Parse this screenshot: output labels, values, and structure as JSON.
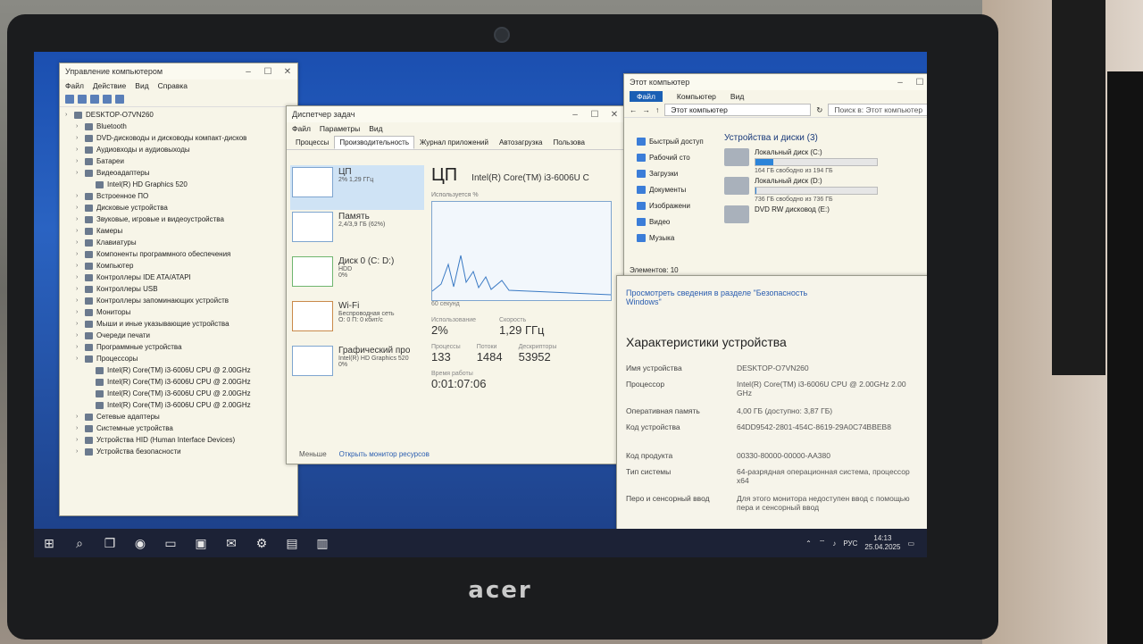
{
  "laptop": {
    "brand": "acer"
  },
  "computer_management": {
    "title": "Управление компьютером",
    "menu": [
      "Файл",
      "Действие",
      "Вид",
      "Справка"
    ],
    "tree": [
      "DESKTOP-O7VN260",
      "Bluetooth",
      "DVD-дисководы и дисководы компакт-дисков",
      "Аудиовходы и аудиовыходы",
      "Батареи",
      "Видеоадаптеры",
      "Intel(R) HD Graphics 520",
      "Встроенное ПО",
      "Дисковые устройства",
      "Звуковые, игровые и видеоустройства",
      "Камеры",
      "Клавиатуры",
      "Компоненты программного обеспечения",
      "Компьютер",
      "Контроллеры IDE ATA/ATAPI",
      "Контроллеры USB",
      "Контроллеры запоминающих устройств",
      "Мониторы",
      "Мыши и иные указывающие устройства",
      "Очереди печати",
      "Программные устройства",
      "Процессоры",
      "Intel(R) Core(TM) i3-6006U CPU @ 2.00GHz",
      "Intel(R) Core(TM) i3-6006U CPU @ 2.00GHz",
      "Intel(R) Core(TM) i3-6006U CPU @ 2.00GHz",
      "Intel(R) Core(TM) i3-6006U CPU @ 2.00GHz",
      "Сетевые адаптеры",
      "Системные устройства",
      "Устройства HID (Human Interface Devices)",
      "Устройства безопасности"
    ]
  },
  "task_manager": {
    "title": "Диспетчер задач",
    "menu": [
      "Файл",
      "Параметры",
      "Вид"
    ],
    "tabs": [
      "Процессы",
      "Производительность",
      "Журнал приложений",
      "Автозагрузка",
      "Пользова"
    ],
    "side": [
      {
        "name": "ЦП",
        "detail": "2% 1,29 ГГц",
        "sub": ""
      },
      {
        "name": "Память",
        "detail": "2,4/3,9 ГБ (62%)",
        "sub": ""
      },
      {
        "name": "Диск 0 (C: D:)",
        "detail": "HDD",
        "sub": "0%"
      },
      {
        "name": "Wi-Fi",
        "detail": "Беспроводная сеть",
        "sub": "О: 0 П: 0 кбит/с"
      },
      {
        "name": "Графический про",
        "detail": "Intel(R) HD Graphics 520",
        "sub": "0%"
      }
    ],
    "cpu_title": "ЦП",
    "cpu_model": "Intel(R) Core(TM) i3-6006U C",
    "graph_label": "Используется %",
    "graph_footer": "60 секунд",
    "usage_label": "Использование",
    "usage": "2%",
    "speed_label": "Скорость",
    "speed": "1,29 ГГц",
    "procs_label": "Процессы",
    "procs": "133",
    "threads_label": "Потоки",
    "threads": "1484",
    "handles_label": "Дескрипторы",
    "handles": "53952",
    "uptime_label": "Время работы",
    "uptime": "0:01:07:06",
    "less": "Меньше",
    "resmon": "Открыть монитор ресурсов"
  },
  "explorer": {
    "title": "Этот компьютер",
    "ribbon": [
      "Файл",
      "Компьютер",
      "Вид"
    ],
    "path": "Этот компьютер",
    "search": "Поиск в: Этот компьютер",
    "nav": [
      "Быстрый доступ",
      "Рабочий сто",
      "Загрузки",
      "Документы",
      "Изображени",
      "Видео",
      "Музыка"
    ],
    "group": "Устройства и диски (3)",
    "drives": [
      {
        "name": "Локальный диск (C:)",
        "free": "164 ГБ свободно из 194 ГБ",
        "used_fraction": 0.15
      },
      {
        "name": "Локальный диск (D:)",
        "free": "736 ГБ свободно из 736 ГБ",
        "used_fraction": 0.01
      },
      {
        "name": "DVD RW дисковод (E:)",
        "free": "",
        "used_fraction": 0
      }
    ],
    "status": "Элементов: 10"
  },
  "settings": {
    "link": "Просмотреть сведения в разделе \"Безопасность Windows\"",
    "heading": "Характеристики устройства",
    "rows": [
      {
        "k": "Имя устройства",
        "v": "DESKTOP-O7VN260"
      },
      {
        "k": "Процессор",
        "v": "Intel(R) Core(TM) i3-6006U CPU @ 2.00GHz 2.00 GHz"
      },
      {
        "k": "Оперативная память",
        "v": "4,00 ГБ (доступно: 3,87 ГБ)"
      },
      {
        "k": "Код устройства",
        "v": "64DD9542-2801-454C-8619-29A0C74BBEB8"
      },
      {
        "k": "Код продукта",
        "v": "00330-80000-00000-AA380"
      },
      {
        "k": "Тип системы",
        "v": "64-разрядная операционная система, процессор x64"
      },
      {
        "k": "Перо и сенсорный ввод",
        "v": "Для этого монитора недоступен ввод с помощью пера и сенсорный ввод"
      }
    ]
  },
  "taskbar": {
    "lang": "РУС",
    "time": "14:13",
    "date": "25.04.2025"
  }
}
